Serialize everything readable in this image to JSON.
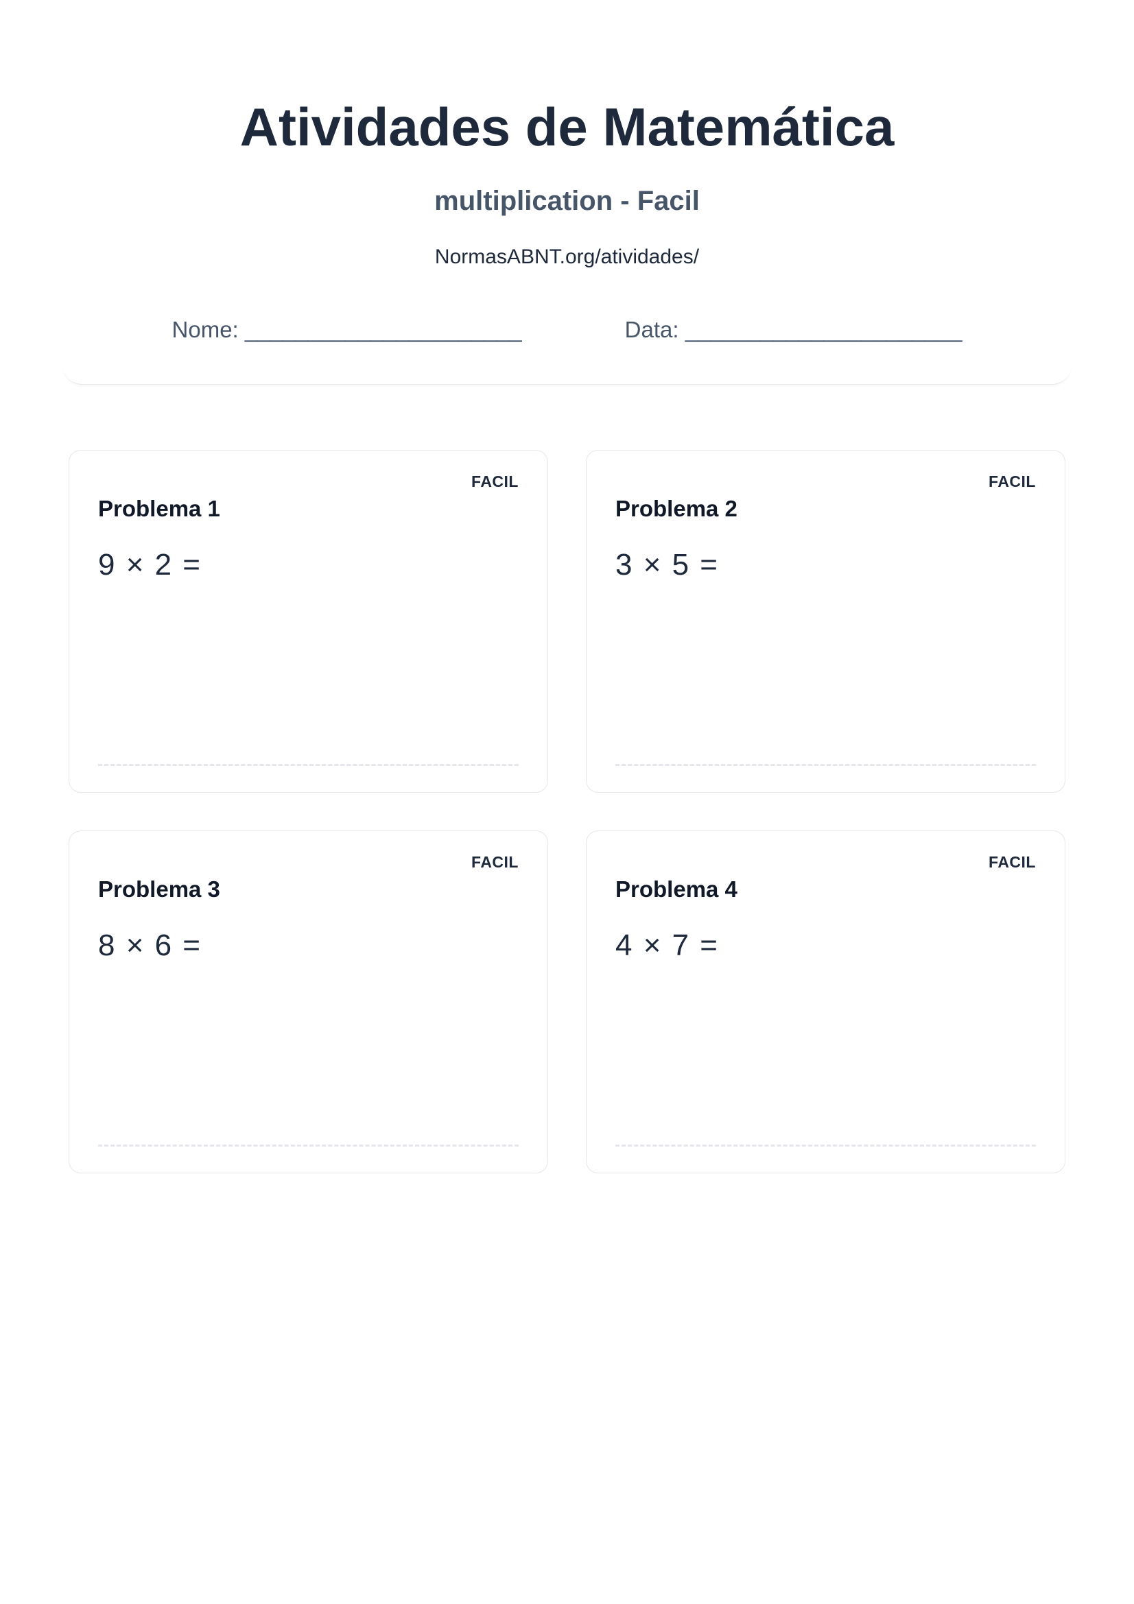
{
  "header": {
    "title": "Atividades de Matemática",
    "subtitle": "multiplication - Facil",
    "source": "NormasABNT.org/atividades/",
    "name_label": "Nome: ______________________",
    "date_label": "Data: ______________________"
  },
  "problems": [
    {
      "title": "Problema 1",
      "difficulty": "FACIL",
      "expression": "9 × 2 ="
    },
    {
      "title": "Problema 2",
      "difficulty": "FACIL",
      "expression": "3 × 5 ="
    },
    {
      "title": "Problema 3",
      "difficulty": "FACIL",
      "expression": "8 × 6 ="
    },
    {
      "title": "Problema 4",
      "difficulty": "FACIL",
      "expression": "4 × 7 ="
    }
  ]
}
